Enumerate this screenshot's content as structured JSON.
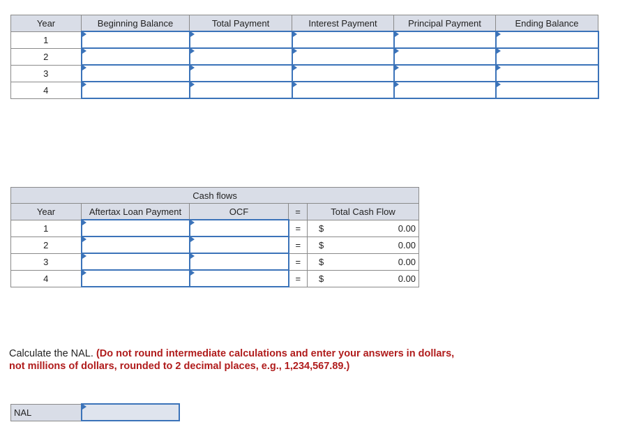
{
  "amortization": {
    "headers": [
      "Year",
      "Beginning Balance",
      "Total Payment",
      "Interest Payment",
      "Principal Payment",
      "Ending Balance"
    ],
    "years": [
      "1",
      "2",
      "3",
      "4"
    ]
  },
  "cashflows": {
    "title": "Cash flows",
    "headers": [
      "Year",
      "Aftertax Loan Payment",
      "OCF",
      "=",
      "Total Cash Flow"
    ],
    "rows": [
      {
        "year": "1",
        "eq": "=",
        "currency": "$",
        "total": "0.00"
      },
      {
        "year": "2",
        "eq": "=",
        "currency": "$",
        "total": "0.00"
      },
      {
        "year": "3",
        "eq": "=",
        "currency": "$",
        "total": "0.00"
      },
      {
        "year": "4",
        "eq": "=",
        "currency": "$",
        "total": "0.00"
      }
    ]
  },
  "instruction": {
    "text": "Calculate the NAL.",
    "note": "(Do not round intermediate calculations and enter your answers in dollars, not millions of dollars, rounded to 2 decimal places, e.g., 1,234,567.89.)"
  },
  "nal": {
    "label": "NAL"
  }
}
